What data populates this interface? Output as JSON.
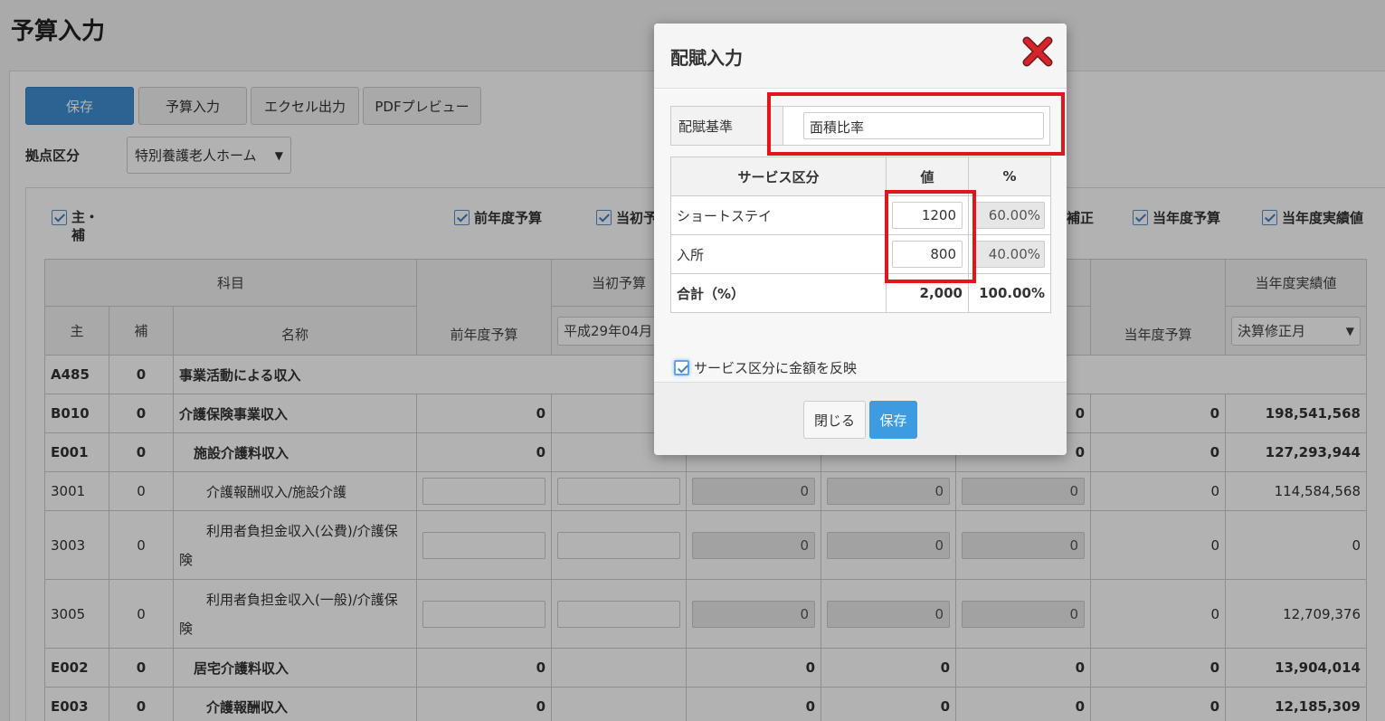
{
  "page": {
    "title": "予算入力"
  },
  "toolbar": {
    "save": "保存",
    "budget_input": "予算入力",
    "excel": "エクセル出力",
    "pdf": "PDFプレビュー"
  },
  "base": {
    "label": "拠点区分",
    "value": "特別養護老人ホーム",
    "arrow": "▼"
  },
  "checkboxes": {
    "main_sub_1": "主・",
    "main_sub_2": "補",
    "prev": "前年度予算",
    "initial": "当初予",
    "correction": "補正",
    "current": "当年度予算",
    "actual": "当年度実績値"
  },
  "grid": {
    "headers": {
      "subject": "科目",
      "main": "主",
      "sub": "補",
      "name": "名称",
      "prev": "前年度予算",
      "initial": "当初予算",
      "initial_select": "平成29年04月",
      "current": "当年度予算",
      "actual": "当年度実績値",
      "actual_select": "決算修正月",
      "arrow": "▼"
    },
    "rows": [
      {
        "main": "A485",
        "sub": "0",
        "name": "事業活動による収入"
      },
      {
        "main": "B010",
        "sub": "0",
        "name": "介護保険事業収入",
        "prev": "0",
        "c2": "0",
        "current": "0",
        "actual": "198,541,568"
      },
      {
        "main": "E001",
        "sub": "0",
        "name": "施設介護料収入",
        "prev": "0",
        "c2": "0",
        "current": "0",
        "actual": "127,293,944"
      },
      {
        "main": "3001",
        "sub": "0",
        "name": "介護報酬収入/施設介護",
        "v1": "0",
        "v2": "0",
        "v3": "0",
        "current": "0",
        "actual": "114,584,568"
      },
      {
        "main": "3003",
        "sub": "0",
        "name1": "利用者負担金収入(公費)/介護保",
        "name2": "険",
        "v1": "0",
        "v2": "0",
        "v3": "0",
        "current": "0",
        "actual": "0"
      },
      {
        "main": "3005",
        "sub": "0",
        "name1": "利用者負担金収入(一般)/介護保",
        "name2": "険",
        "v1": "0",
        "v2": "0",
        "v3": "0",
        "current": "0",
        "actual": "12,709,376"
      },
      {
        "main": "E002",
        "sub": "0",
        "name": "居宅介護料収入",
        "prev": "0",
        "v1": "0",
        "v2": "0",
        "v3": "0",
        "current": "0",
        "actual": "13,904,014"
      },
      {
        "main": "E003",
        "sub": "0",
        "name": "介護報酬収入",
        "prev": "0",
        "v1": "0",
        "v2": "0",
        "v3": "0",
        "current": "0",
        "actual": "12,185,309"
      }
    ]
  },
  "modal": {
    "title": "配賦入力",
    "basis_label": "配賦基準",
    "basis_value": "面積比率",
    "headers": {
      "service": "サービス区分",
      "value": "値",
      "percent": "%"
    },
    "rows": [
      {
        "name": "ショートステイ",
        "value": "1200",
        "percent": "60.00%"
      },
      {
        "name": "入所",
        "value": "800",
        "percent": "40.00%"
      }
    ],
    "total": {
      "label": "合計（%）",
      "value": "2,000",
      "percent": "100.00%"
    },
    "reflect_label": "サービス区分に金額を反映",
    "close": "閉じる",
    "save": "保存"
  },
  "colors": {
    "primary": "#3e8fd3",
    "modal_save": "#3e9be0",
    "highlight": "#e0151e",
    "close_icon": "#d9232a"
  }
}
